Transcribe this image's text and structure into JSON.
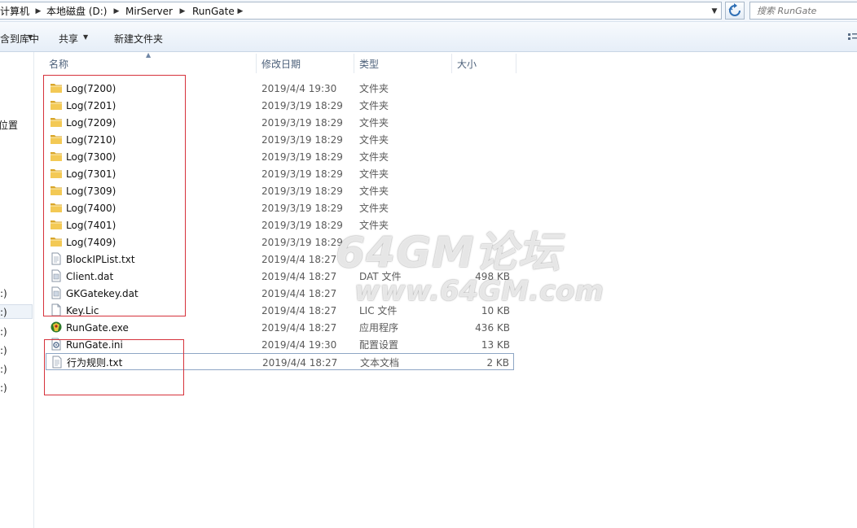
{
  "address_bar": {
    "crumbs": [
      "计算机",
      "本地磁盘 (D:)",
      "MirServer",
      "RunGate"
    ],
    "search_placeholder": "搜索 RunGate"
  },
  "toolbar": {
    "include_in_library": "包含到库中",
    "share": "共享",
    "new_folder": "新建文件夹"
  },
  "nav_pane": {
    "items": [
      "位置",
      ":)",
      ":)",
      ":)",
      ":)",
      ":)",
      ":)"
    ]
  },
  "columns": {
    "name": "名称",
    "modified": "修改日期",
    "type": "类型",
    "size": "大小"
  },
  "files": [
    {
      "icon": "folder-icon",
      "name": "Log(7200)",
      "date": "2019/4/4 19:30",
      "type": "文件夹",
      "size": ""
    },
    {
      "icon": "folder-icon",
      "name": "Log(7201)",
      "date": "2019/3/19 18:29",
      "type": "文件夹",
      "size": ""
    },
    {
      "icon": "folder-icon",
      "name": "Log(7209)",
      "date": "2019/3/19 18:29",
      "type": "文件夹",
      "size": ""
    },
    {
      "icon": "folder-icon",
      "name": "Log(7210)",
      "date": "2019/3/19 18:29",
      "type": "文件夹",
      "size": ""
    },
    {
      "icon": "folder-icon",
      "name": "Log(7300)",
      "date": "2019/3/19 18:29",
      "type": "文件夹",
      "size": ""
    },
    {
      "icon": "folder-icon",
      "name": "Log(7301)",
      "date": "2019/3/19 18:29",
      "type": "文件夹",
      "size": ""
    },
    {
      "icon": "folder-icon",
      "name": "Log(7309)",
      "date": "2019/3/19 18:29",
      "type": "文件夹",
      "size": ""
    },
    {
      "icon": "folder-icon",
      "name": "Log(7400)",
      "date": "2019/3/19 18:29",
      "type": "文件夹",
      "size": ""
    },
    {
      "icon": "folder-icon",
      "name": "Log(7401)",
      "date": "2019/3/19 18:29",
      "type": "文件夹",
      "size": ""
    },
    {
      "icon": "folder-icon",
      "name": "Log(7409)",
      "date": "2019/3/19 18:29",
      "type": "",
      "size": ""
    },
    {
      "icon": "text-file-icon",
      "name": "BlockIPList.txt",
      "date": "2019/4/4 18:27",
      "type": "",
      "size": ""
    },
    {
      "icon": "dat-file-icon",
      "name": "Client.dat",
      "date": "2019/4/4 18:27",
      "type": "DAT 文件",
      "size": "498 KB"
    },
    {
      "icon": "dat-file-icon",
      "name": "GKGatekey.dat",
      "date": "2019/4/4 18:27",
      "type": "",
      "size": ""
    },
    {
      "icon": "blank-file-icon",
      "name": "Key.Lic",
      "date": "2019/4/4 18:27",
      "type": "LIC 文件",
      "size": "10 KB"
    },
    {
      "icon": "exe-app-icon",
      "name": "RunGate.exe",
      "date": "2019/4/4 18:27",
      "type": "应用程序",
      "size": "436 KB"
    },
    {
      "icon": "ini-config-icon",
      "name": "RunGate.ini",
      "date": "2019/4/4 19:30",
      "type": "配置设置",
      "size": "13 KB"
    },
    {
      "icon": "text-file-icon",
      "name": "行为规则.txt",
      "date": "2019/4/4 18:27",
      "type": "文本文档",
      "size": "2 KB"
    }
  ],
  "watermark": {
    "main": "64GM论坛",
    "url": "www.64GM.com"
  },
  "colors": {
    "highlight_box": "#d6323b",
    "folder": "#e8b83c",
    "focus_border": "#8ea6c5"
  }
}
